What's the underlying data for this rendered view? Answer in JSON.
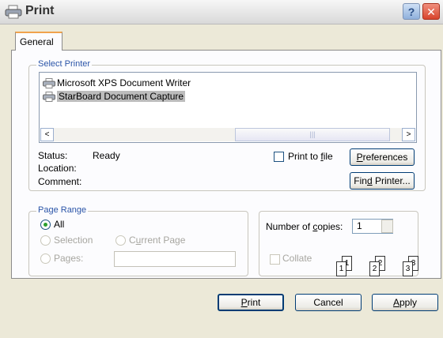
{
  "window": {
    "title": "Print",
    "help_label": "?",
    "close_label": "✕"
  },
  "tabs": [
    {
      "label": "General"
    }
  ],
  "select_printer": {
    "legend": "Select Printer",
    "printers": [
      {
        "name": "Microsoft XPS Document Writer",
        "selected": false
      },
      {
        "name": "StarBoard Document Capture",
        "selected": true
      }
    ],
    "scroll_left": "<",
    "scroll_right": ">",
    "thumb_grip": "|||"
  },
  "status": {
    "status_label": "Status:",
    "status_value": "Ready",
    "location_label": "Location:",
    "location_value": "",
    "comment_label": "Comment:",
    "comment_value": ""
  },
  "print_to_file": {
    "pre": "Print to ",
    "u": "f",
    "post": "ile",
    "checked": false
  },
  "preferences_button": {
    "u": "P",
    "rest": "references"
  },
  "find_printer_button": {
    "pre": "Fin",
    "u": "d",
    "post": " Printer..."
  },
  "page_range": {
    "legend": "Page Range",
    "all": {
      "label": "All",
      "selected": true
    },
    "selection": {
      "label": "Selection"
    },
    "current_page": {
      "pre": "C",
      "u": "u",
      "post": "rrent Page"
    },
    "pages": {
      "label": "Pages:",
      "value": ""
    }
  },
  "copies": {
    "label_pre": "Number of ",
    "label_u": "c",
    "label_post": "opies:",
    "value": "1",
    "collate": {
      "label": "Collate",
      "checked": false
    },
    "pages": [
      "1",
      "1",
      "2",
      "2",
      "3",
      "3"
    ]
  },
  "footer": {
    "print": {
      "u": "P",
      "rest": "rint"
    },
    "cancel": "Cancel",
    "apply": {
      "u": "A",
      "rest": "pply"
    }
  },
  "colors": {
    "legend_text": "#2b55a8",
    "dialog_bg": "#ece9d8",
    "panel_bg": "#fcfcfe",
    "selection_bg": "#bcbcbc"
  }
}
